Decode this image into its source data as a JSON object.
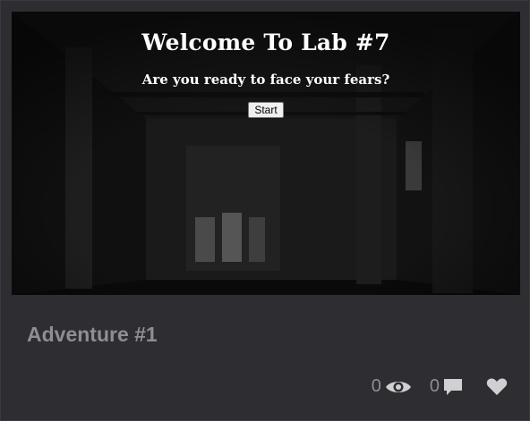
{
  "preview": {
    "heading": "Welcome To Lab #7",
    "subheading": "Are you ready to face your fears?",
    "start_label": "Start"
  },
  "card": {
    "title": "Adventure #1",
    "views_count": "0",
    "comments_count": "0",
    "view_icon": "eye-icon",
    "comment_icon": "comment-icon",
    "like_icon": "heart-icon"
  },
  "colors": {
    "background": "#2e2e32",
    "muted_text": "#8f8f92",
    "icon": "#d0d0d2"
  }
}
